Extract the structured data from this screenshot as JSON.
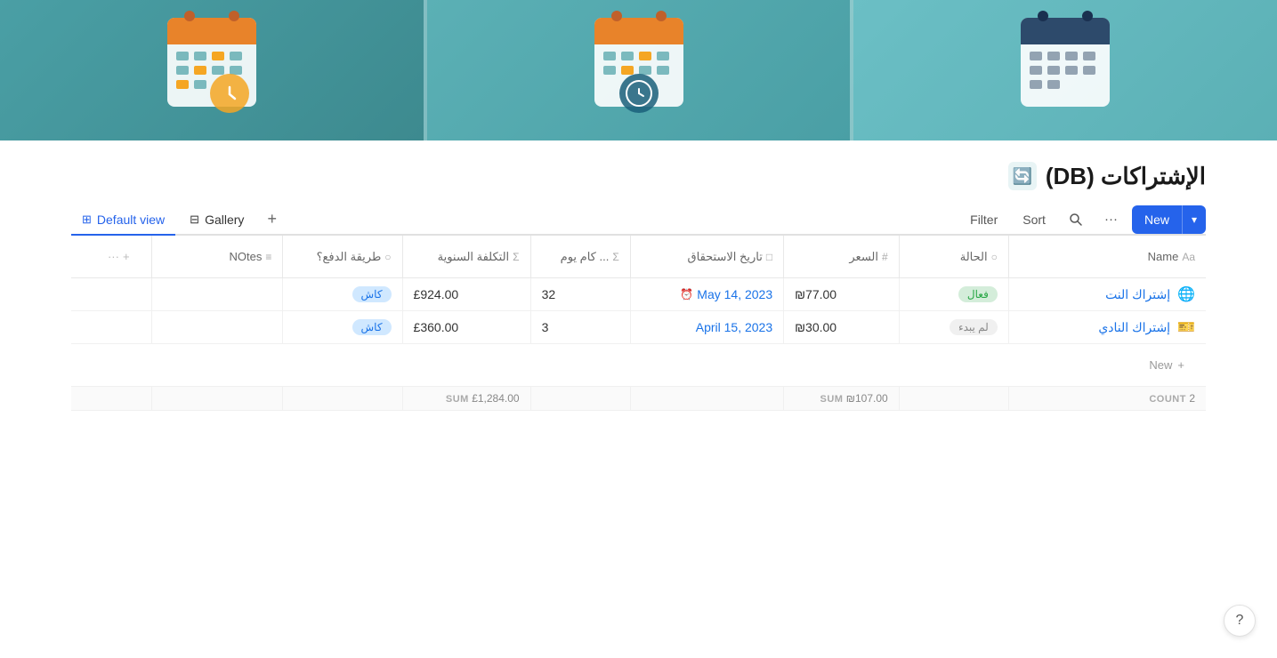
{
  "banner": {
    "sections": [
      "left",
      "middle",
      "right"
    ]
  },
  "page": {
    "title": "الإشتراكات (DB)",
    "icon": "🔄"
  },
  "toolbar": {
    "views": [
      {
        "id": "default",
        "label": "Default view",
        "active": true,
        "icon": "⊞"
      },
      {
        "id": "gallery",
        "label": "Gallery",
        "active": false,
        "icon": "⊟"
      }
    ],
    "add_view": "+",
    "filter_label": "Filter",
    "sort_label": "Sort",
    "new_label": "New",
    "new_arrow": "▾",
    "more_icon": "···"
  },
  "table": {
    "columns": [
      {
        "id": "name",
        "label": "Name",
        "type_icon": "Aa"
      },
      {
        "id": "status",
        "label": "الحالة",
        "type_icon": "○"
      },
      {
        "id": "price",
        "label": "السعر",
        "type_icon": "#"
      },
      {
        "id": "date",
        "label": "تاريخ الاستحقاق",
        "type_icon": "□"
      },
      {
        "id": "days",
        "label": "... كام يوم",
        "type_icon": "Σ"
      },
      {
        "id": "annual",
        "label": "التكلفة السنوية",
        "type_icon": "Σ"
      },
      {
        "id": "payment",
        "label": "طريقة الدفع؟",
        "type_icon": "○"
      },
      {
        "id": "notes",
        "label": "NOtes",
        "type_icon": "≡"
      }
    ],
    "rows": [
      {
        "id": 1,
        "name": "إشتراك النت",
        "name_icon": "🌐",
        "status": "فعال",
        "status_type": "green",
        "price": "₪77.00",
        "date": "May 14, 2023",
        "date_has_alarm": true,
        "days": "32",
        "annual": "£924.00",
        "payment": "كاش",
        "payment_type": "blue",
        "notes": ""
      },
      {
        "id": 2,
        "name": "إشتراك النادي",
        "name_icon": "🎫",
        "status": "لم يبدء",
        "status_type": "gray",
        "price": "₪30.00",
        "date": "April 15, 2023",
        "date_has_alarm": false,
        "days": "3",
        "annual": "£360.00",
        "payment": "كاش",
        "payment_type": "blue",
        "notes": ""
      }
    ],
    "footer": {
      "count_label": "COUNT",
      "count_value": "2",
      "sum_price_label": "SUM",
      "sum_price_value": "₪107.00",
      "sum_annual_label": "SUM",
      "sum_annual_value": "£1,284.00"
    },
    "add_row_label": "New"
  },
  "help": "?"
}
